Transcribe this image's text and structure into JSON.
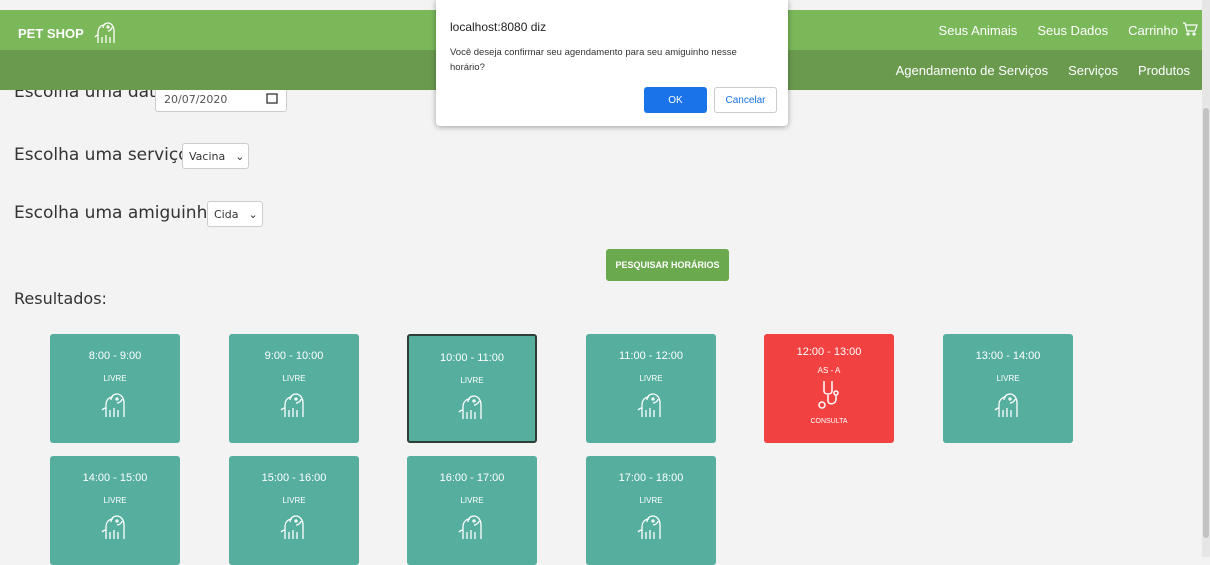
{
  "header": {
    "brand": "PET SHOP",
    "nav": [
      "Seus Animais",
      "Seus Dados",
      "Carrinho"
    ],
    "subnav": [
      "Agendamento de Serviços",
      "Serviços",
      "Produtos"
    ]
  },
  "form": {
    "date_label": "Escolha uma data:",
    "date_value": "20/07/2020",
    "service_label": "Escolha uma serviço:",
    "service_value": "Vacina",
    "pet_label": "Escolha uma amiguinho:",
    "pet_value": "Cida",
    "search_button": "PESQUISAR HORÁRIOS"
  },
  "results": {
    "title": "Resultados:",
    "slots": [
      {
        "time": "8:00 - 9:00",
        "status": "LIVRE"
      },
      {
        "time": "9:00 - 10:00",
        "status": "LIVRE"
      },
      {
        "time": "10:00 - 11:00",
        "status": "LIVRE"
      },
      {
        "time": "11:00 - 12:00",
        "status": "LIVRE"
      },
      {
        "time": "12:00 - 13:00",
        "status": "AS - A",
        "service": "CONSULTA"
      },
      {
        "time": "13:00 - 14:00",
        "status": "LIVRE"
      },
      {
        "time": "14:00 - 15:00",
        "status": "LIVRE"
      },
      {
        "time": "15:00 - 16:00",
        "status": "LIVRE"
      },
      {
        "time": "16:00 - 17:00",
        "status": "LIVRE"
      },
      {
        "time": "17:00 - 18:00",
        "status": "LIVRE"
      }
    ]
  },
  "dialog": {
    "title": "localhost:8080 diz",
    "message": "Você deseja confirmar seu agendamento para seu amiguinho nesse horário?",
    "ok": "OK",
    "cancel": "Cancelar"
  },
  "colors": {
    "header": "#7ab85a",
    "subheader": "#6a9a4e",
    "free_slot": "#56ae9f",
    "busy_slot": "#f24141",
    "dialog_button": "#1a73e8"
  }
}
